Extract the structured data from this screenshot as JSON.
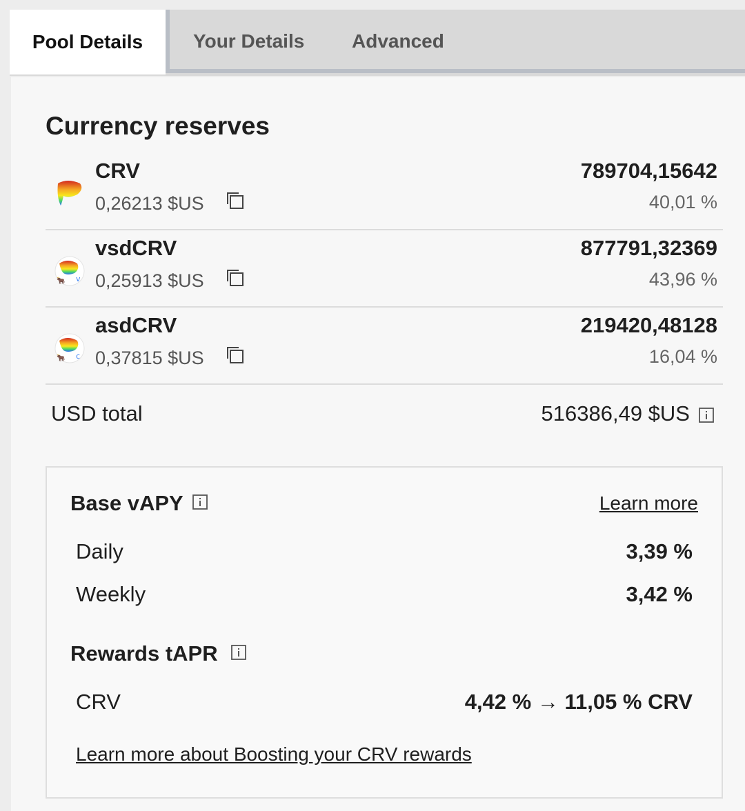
{
  "tabs": [
    {
      "label": "Pool Details"
    },
    {
      "label": "Your Details"
    },
    {
      "label": "Advanced"
    }
  ],
  "reserves": {
    "title": "Currency reserves",
    "items": [
      {
        "name": "CRV",
        "price": "0,26213 $US",
        "amount": "789704,15642",
        "percent": "40,01 %",
        "icon": "crv-logo-icon"
      },
      {
        "name": "vsdCRV",
        "price": "0,25913 $US",
        "amount": "877791,32369",
        "percent": "43,96 %",
        "icon": "vsdcrv-logo-icon"
      },
      {
        "name": "asdCRV",
        "price": "0,37815 $US",
        "amount": "219420,48128",
        "percent": "16,04 %",
        "icon": "asdcrv-logo-icon"
      }
    ],
    "usd_total_label": "USD total",
    "usd_total_value": "516386,49 $US"
  },
  "apy": {
    "base_title": "Base vAPY",
    "learn_more": "Learn more",
    "daily_label": "Daily",
    "daily_value": "3,39 %",
    "weekly_label": "Weekly",
    "weekly_value": "3,42 %",
    "rewards_title": "Rewards tAPR",
    "reward_label": "CRV",
    "reward_value": "4,42 % → 11,05 % CRV",
    "boost_link": "Learn more about Boosting your CRV rewards"
  },
  "colors": {
    "tab_bar": "#d9d9d9",
    "tab_underline": "#b9bec6",
    "panel_bg": "#f7f7f7",
    "text_primary": "#1f1f1f",
    "text_secondary": "#555555"
  }
}
